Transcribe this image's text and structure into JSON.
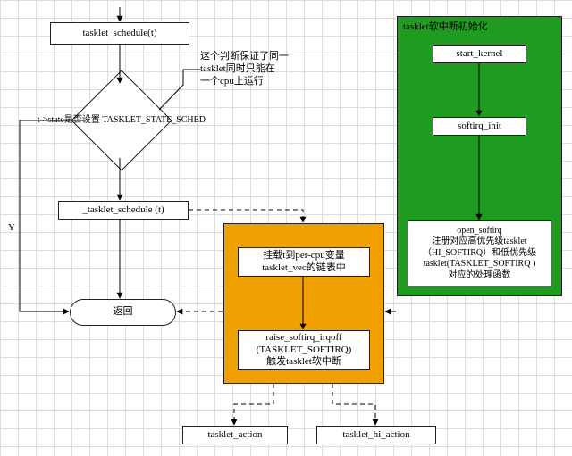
{
  "nodes": {
    "n_schedule": "tasklet_schedule(t)",
    "n_decision": "t->state是否设置\nTASKLET_STATE_SCHED",
    "n_cbschedule": "_tasklet_schedule (t)",
    "n_return": "返回",
    "n_orange1": "挂载t到per-cpu变量\ntasklet_vec的链表中",
    "n_orange2": "raise_softirq_irqoff\n(TASKLET_SOFTIRQ)\n触发tasklet软中断",
    "n_action": "tasklet_action",
    "n_hi_action": "tasklet_hi_action",
    "n_start": "start_kernel",
    "n_sinit": "softirq_init",
    "n_open": "open_softirq\n注册对应高优先级tasklet\n（HI_SOFTIRQ）和低优先级\ntasklet(TASKLET_SOFTIRQ )\n对应的处理函数"
  },
  "labels": {
    "green_title": "tasklet软中断初始化",
    "note1": "这个判断保证了同一\ntasklet同时只能在\n一个cpu上运行",
    "Y": "Y"
  }
}
